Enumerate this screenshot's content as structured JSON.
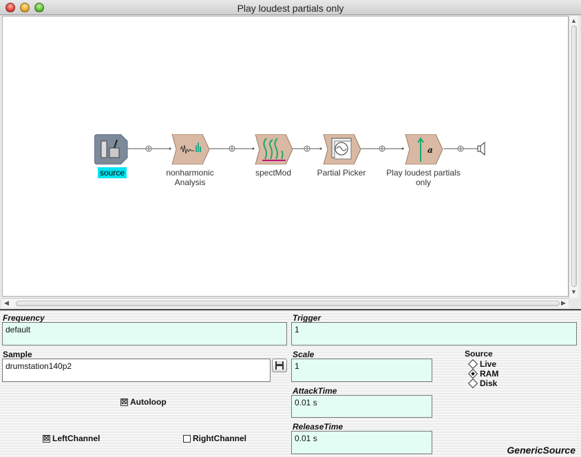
{
  "window": {
    "title": "Play loudest partials only"
  },
  "graph": {
    "modules": [
      {
        "id": "source",
        "label": "source",
        "selected": true
      },
      {
        "id": "nonharmonic",
        "label_line1": "nonharmonic",
        "label_line2": "Analysis"
      },
      {
        "id": "spectmod",
        "label": "spectMod"
      },
      {
        "id": "partialpicker",
        "label": "Partial Picker"
      },
      {
        "id": "playloudest",
        "label_line1": "Play loudest partials",
        "label_line2": "only"
      }
    ],
    "colors": {
      "selection": "#00e5f2",
      "module_body": "#d8b8a2"
    }
  },
  "params": {
    "frequency": {
      "label": "Frequency",
      "value": "default"
    },
    "trigger": {
      "label": "Trigger",
      "value": "1"
    },
    "sample": {
      "label": "Sample",
      "value": "drumstation140p2"
    },
    "scale": {
      "label": "Scale",
      "value": "1"
    },
    "source": {
      "label": "Source",
      "options": [
        "Live",
        "RAM",
        "Disk"
      ],
      "selected": "RAM"
    },
    "autoloop": {
      "label": "Autoloop",
      "checked": true
    },
    "attack": {
      "label": "AttackTime",
      "value": "0.01 s"
    },
    "release": {
      "label": "ReleaseTime",
      "value": "0.01 s"
    },
    "left": {
      "label": "LeftChannel",
      "checked": true
    },
    "right": {
      "label": "RightChannel",
      "checked": false
    },
    "class_name": "GenericSource"
  },
  "colors": {
    "field_bg": "#e3fdf4"
  }
}
